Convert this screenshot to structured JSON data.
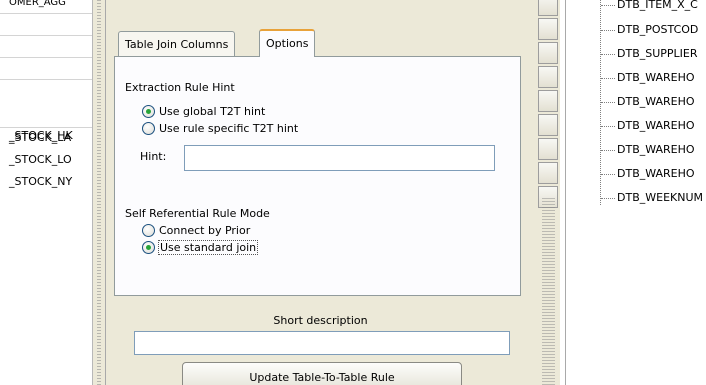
{
  "left_list": {
    "rows": [
      "OMER_AGG",
      "",
      "",
      "",
      "_STOCK_HK",
      "_STOCK_LA",
      "_STOCK_LO",
      "_STOCK_NY"
    ]
  },
  "tabs": [
    {
      "label": "Table Join Columns",
      "selected": false
    },
    {
      "label": "Options",
      "selected": true
    }
  ],
  "options": {
    "extraction_hint_heading": "Extraction Rule Hint",
    "radio_global": "Use global T2T hint",
    "radio_specific": "Use rule specific T2T hint",
    "hint_label": "Hint:",
    "hint_value": "",
    "self_ref_heading": "Self Referential Rule Mode",
    "radio_prior": "Connect by Prior",
    "radio_standard": "Use standard join"
  },
  "short_description": {
    "label": "Short description",
    "value": ""
  },
  "update_button": "Update Table-To-Table Rule",
  "tree_items": [
    "DTB_ITEM_X_C",
    "DTB_POSTCOD",
    "DTB_SUPPLIER",
    "DTB_WAREHO",
    "DTB_WAREHO",
    "DTB_WAREHO",
    "DTB_WAREHO",
    "DTB_WAREHO",
    "DTB_WEEKNUM"
  ],
  "colors": {
    "panel_bg": "#ece9d8",
    "tab_highlight": "#e8a23a",
    "radio_dot": "#27a43a"
  }
}
